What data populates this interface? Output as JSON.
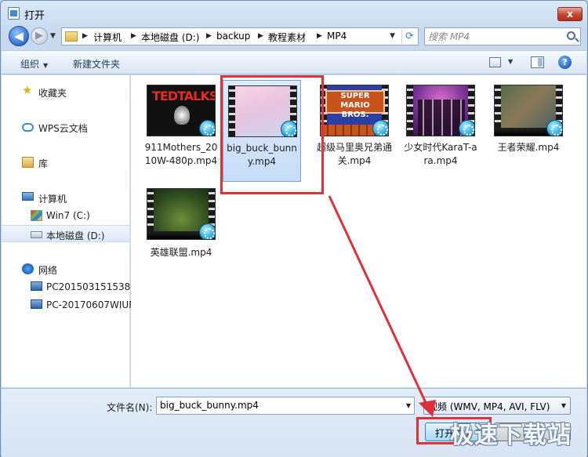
{
  "window": {
    "title": "打开",
    "close_label": "x"
  },
  "nav": {
    "back_glyph": "◀",
    "forward_glyph": "▶",
    "breadcrumb": [
      "计算机",
      "本地磁盘 (D:)",
      "backup",
      "教程素材",
      "MP4"
    ],
    "search_placeholder": "搜索 MP4"
  },
  "toolbar": {
    "organize_label": "组织",
    "new_folder_label": "新建文件夹",
    "help_label": "?"
  },
  "sidebar": {
    "items": [
      {
        "label": "收藏夹",
        "icon": "star-icon"
      },
      {
        "label": "WPS云文档",
        "icon": "cloud-icon"
      },
      {
        "label": "库",
        "icon": "library-icon"
      },
      {
        "label": "计算机",
        "icon": "computer-icon"
      },
      {
        "label": "Win7 (C:)",
        "icon": "drive-win-icon"
      },
      {
        "label": "本地磁盘 (D:)",
        "icon": "drive-icon",
        "selected": true
      },
      {
        "label": "网络",
        "icon": "network-icon"
      },
      {
        "label": "PC201503151538",
        "icon": "pc-icon"
      },
      {
        "label": "PC-20170607WIUN",
        "icon": "pc-icon"
      }
    ]
  },
  "files": [
    {
      "name": "911Mothers_2010W-480p.mp4",
      "thumb_text": "TEDTALKS"
    },
    {
      "name": "big_buck_bunny.mp4",
      "selected": true
    },
    {
      "name": "超级马里奥兄弟通关.mp4",
      "thumb_text": "SUPER MARIO BROS."
    },
    {
      "name": "少女时代KaraT-ara.mp4"
    },
    {
      "name": "王者荣耀.mp4"
    },
    {
      "name": "英雄联盟.mp4"
    }
  ],
  "bottom": {
    "filename_label": "文件名(N):",
    "filename_value": "big_buck_bunny.mp4",
    "filetype_value": "视频 (WMV, MP4, AVI, FLV)",
    "open_label": "打开(O)",
    "cancel_label": "取消"
  },
  "watermark": "极速下载站",
  "colors": {
    "annotation_red": "#e0303a",
    "accent_blue": "#3d8be0"
  }
}
